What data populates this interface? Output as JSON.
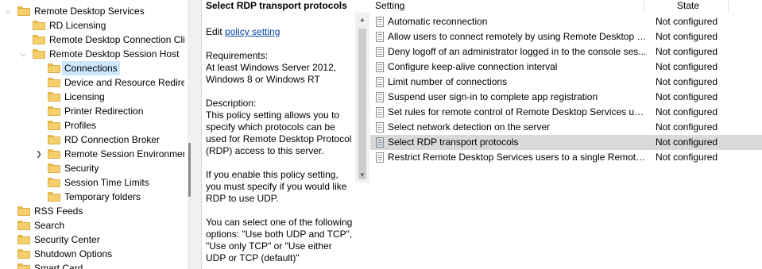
{
  "tree": {
    "items": [
      {
        "label": "Remote Desktop Services",
        "caret": "open"
      },
      {
        "label": "RD Licensing",
        "caret": ""
      },
      {
        "label": "Remote Desktop Connection Cli",
        "caret": ""
      },
      {
        "label": "Remote Desktop Session Host",
        "caret": "open"
      },
      {
        "label": "Connections",
        "caret": "",
        "selected": true
      },
      {
        "label": "Device and Resource Redirec",
        "caret": ""
      },
      {
        "label": "Licensing",
        "caret": ""
      },
      {
        "label": "Printer Redirection",
        "caret": ""
      },
      {
        "label": "Profiles",
        "caret": ""
      },
      {
        "label": "RD Connection Broker",
        "caret": ""
      },
      {
        "label": "Remote Session Environmen",
        "caret": "closed"
      },
      {
        "label": "Security",
        "caret": ""
      },
      {
        "label": "Session Time Limits",
        "caret": ""
      },
      {
        "label": "Temporary folders",
        "caret": ""
      },
      {
        "label": "RSS Feeds",
        "caret": ""
      },
      {
        "label": "Search",
        "caret": ""
      },
      {
        "label": "Security Center",
        "caret": ""
      },
      {
        "label": "Shutdown Options",
        "caret": ""
      },
      {
        "label": "Smart Card",
        "caret": ""
      }
    ]
  },
  "description": {
    "title": "Select RDP transport protocols",
    "edit_prefix": "Edit ",
    "edit_link": "policy setting",
    "requirements_label": "Requirements:",
    "requirements_text": "At least Windows Server 2012, Windows 8 or Windows RT",
    "description_label": "Description:",
    "para1": "This policy setting allows you to specify which protocols can be used for Remote Desktop Protocol (RDP) access to this server.",
    "para2": "If you enable this policy setting, you must specify if you would like RDP to use UDP.",
    "para3": "You can select one of the following options: \"Use both UDP and TCP\", \"Use only TCP\" or \"Use either UDP or TCP (default)\""
  },
  "list": {
    "header_setting": "Setting",
    "header_state": "State",
    "rows": [
      {
        "name": "Automatic reconnection",
        "state": "Not configured"
      },
      {
        "name": "Allow users to connect remotely by using Remote Desktop S...",
        "state": "Not configured"
      },
      {
        "name": "Deny logoff of an administrator logged in to the console ses...",
        "state": "Not configured"
      },
      {
        "name": "Configure keep-alive connection interval",
        "state": "Not configured"
      },
      {
        "name": "Limit number of connections",
        "state": "Not configured"
      },
      {
        "name": "Suspend user sign-in to complete app registration",
        "state": "Not configured"
      },
      {
        "name": "Set rules for remote control of Remote Desktop Services use...",
        "state": "Not configured"
      },
      {
        "name": "Select network detection on the server",
        "state": "Not configured"
      },
      {
        "name": "Select RDP transport protocols",
        "state": "Not configured",
        "selected": true
      },
      {
        "name": "Restrict Remote Desktop Services users to a single Remote D...",
        "state": "Not configured"
      }
    ]
  },
  "icons": {
    "folder": "folder-icon",
    "policy": "policy-setting-icon",
    "expand": "chevron-down-icon",
    "collapse": "chevron-right-icon"
  }
}
